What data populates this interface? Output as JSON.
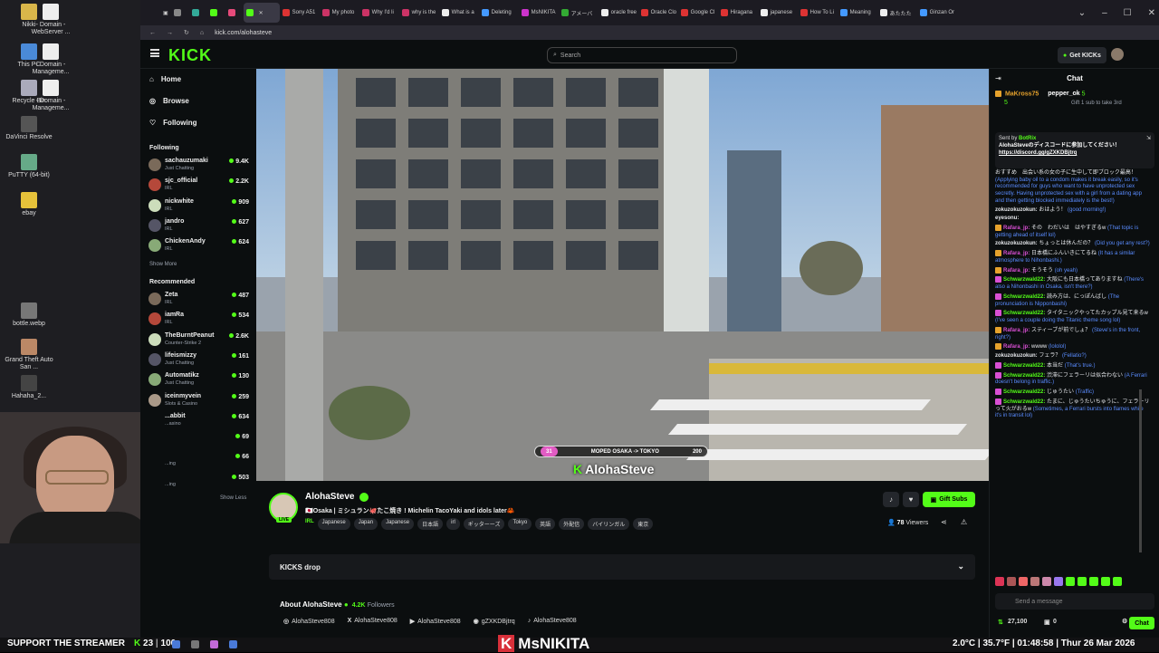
{
  "desktop": {
    "icons": [
      {
        "label": "Nikki",
        "color": "#d9b64a"
      },
      {
        "label": "- Domain - WebServer ...",
        "color": "#eee"
      },
      {
        "label": "This PC",
        "color": "#4a8ad8"
      },
      {
        "label": "- Domain - Manageme...",
        "color": "#eee"
      },
      {
        "label": "Recycle Bin",
        "color": "#aab"
      },
      {
        "label": "- Domain - Manageme...",
        "color": "#eee"
      },
      {
        "label": "DaVinci Resolve",
        "color": "#555"
      },
      {
        "label": "PuTTY (64-bit)",
        "color": "#6a8"
      },
      {
        "label": "ebay",
        "color": "#e6c23a"
      },
      {
        "label": "bottle.webp",
        "color": "#777"
      },
      {
        "label": "Grand Theft Auto San ...",
        "color": "#b86"
      },
      {
        "label": "Hahaha_2...",
        "color": "#444"
      }
    ]
  },
  "browser": {
    "tabs": [
      {
        "label": "",
        "color": "#888"
      },
      {
        "label": "",
        "color": "#3a9"
      },
      {
        "label": "",
        "color": "#53fc18"
      },
      {
        "label": "",
        "color": "#e64a7a"
      },
      {
        "label": "",
        "color": "#53fc18",
        "active": true
      },
      {
        "label": "Sony A51",
        "color": "#d33"
      },
      {
        "label": "My photo",
        "color": "#c36"
      },
      {
        "label": "Why I'd li",
        "color": "#c36"
      },
      {
        "label": "why is the",
        "color": "#c36"
      },
      {
        "label": "What is a",
        "color": "#eee"
      },
      {
        "label": "Deleting",
        "color": "#49f"
      },
      {
        "label": "MsNIKITA",
        "color": "#c3c"
      },
      {
        "label": "アメーバ",
        "color": "#3a3"
      },
      {
        "label": "oracle free",
        "color": "#eee"
      },
      {
        "label": "Oracle Clo",
        "color": "#d33"
      },
      {
        "label": "Google Cl",
        "color": "#d33"
      },
      {
        "label": "Hiragana",
        "color": "#d33"
      },
      {
        "label": "japanese",
        "color": "#eee"
      },
      {
        "label": "How To Li",
        "color": "#d33"
      },
      {
        "label": "Meaning",
        "color": "#49f"
      },
      {
        "label": "あたたた",
        "color": "#eee"
      },
      {
        "label": "Ginzan Or",
        "color": "#49f"
      }
    ],
    "url": "kick.com/alohasteve"
  },
  "topnav": {
    "logo": "KICK",
    "search_placeholder": "Search",
    "get_kicks": "Get KICKs"
  },
  "sidebar": {
    "nav": [
      "Home",
      "Browse",
      "Following"
    ],
    "following_title": "Following",
    "following": [
      {
        "name": "sachauzumaki",
        "category": "Just Chatting",
        "viewers": "9.4K"
      },
      {
        "name": "sjc_official",
        "category": "IRL",
        "viewers": "2.2K"
      },
      {
        "name": "nickwhite",
        "category": "IRL",
        "viewers": "909"
      },
      {
        "name": "jandro",
        "category": "IRL",
        "viewers": "627"
      },
      {
        "name": "ChickenAndy",
        "category": "IRL",
        "viewers": "624"
      }
    ],
    "show_more": "Show More",
    "recommended_title": "Recommended",
    "recommended": [
      {
        "name": "Zeta",
        "category": "IRL",
        "viewers": "487"
      },
      {
        "name": "iamRa",
        "category": "IRL",
        "viewers": "534"
      },
      {
        "name": "TheBurntPeanut",
        "category": "Counter-Strike 2",
        "viewers": "2.6K"
      },
      {
        "name": "lifeismizzy",
        "category": "Just Chatting",
        "viewers": "161"
      },
      {
        "name": "Automatikz",
        "category": "Just Chatting",
        "viewers": "130"
      },
      {
        "name": "iceinmyvein",
        "category": "Slots & Casino",
        "viewers": "259"
      },
      {
        "name": "...abbit",
        "category": "...asino",
        "viewers": "634"
      },
      {
        "name": "",
        "category": "",
        "viewers": "69"
      },
      {
        "name": "",
        "category": "...ing",
        "viewers": "66"
      },
      {
        "name": "",
        "category": "...ing",
        "viewers": "503"
      }
    ],
    "show_less": "Show Less"
  },
  "video": {
    "overlay_left": "31",
    "overlay_route": "MOPED OSAKA -> TOKYO",
    "overlay_right": "200",
    "overlay_name": "AlohaSteve"
  },
  "stream": {
    "channel": "AlohaSteve",
    "live_label": "LIVE",
    "title": "🇯🇵Osaka | ミシュラン🐙たこ焼き ! Michelin TacoYaki and idols later🦀",
    "category": "IRL",
    "tags": [
      "Japanese",
      "Japan",
      "Japanese",
      "日本語",
      "irl",
      "ギッターーズ",
      "Tokyo",
      "英語",
      "外配信",
      "バイリンガル",
      "東京"
    ],
    "gift_label": "Gift Subs",
    "viewers": "78",
    "viewers_label": "Viewers",
    "kicks_drop": "KICKS drop",
    "about_title": "About AlohaSteve",
    "followers": "4.2K",
    "followers_label": "Followers",
    "socials": [
      {
        "icon": "instagram-icon",
        "label": "AlohaSteve808"
      },
      {
        "icon": "x-icon",
        "label": "AlohaSteve808"
      },
      {
        "icon": "youtube-icon",
        "label": "AlohaSteve808"
      },
      {
        "icon": "discord-icon",
        "label": "gZXKDBjtrq"
      },
      {
        "icon": "tiktok-icon",
        "label": "AlohaSteve808"
      }
    ]
  },
  "chat": {
    "title": "Chat",
    "gift_user1": "MaKross75",
    "gift_user1_count": "5",
    "gift_user2": "pepper_ok",
    "gift_user2_count": "5",
    "gift_note": "Gift 1 sub to take 3rd",
    "pinned_sender": "Sent by",
    "pinned_bot": "BotRix",
    "pinned_text": "AlohaSteveのディスコードに参加してください！",
    "pinned_link": "https://discord.gg/gZXKDBjtrq",
    "messages": [
      {
        "user": "",
        "color": "#e5e7eb",
        "text": "おすすめ　出会い系の女の子に生中して即ブロック最高！",
        "translation": "(Applying baby oil to a condom makes it break easily, so it's recommended for guys who want to have unprotected sex secretly. Having unprotected sex with a girl from a dating app and then getting blocked immediately is the best!)"
      },
      {
        "user": "zokuzokuzokun:",
        "color": "#e5e7eb",
        "text": "おはよう！",
        "translation": "(good morning!)"
      },
      {
        "user": "eyesonu:",
        "color": "#e5e7eb",
        "text": "",
        "translation": ""
      },
      {
        "user": "Rafara_jp:",
        "color": "#d94fd4",
        "text": "その　わだいは　はやすぎるw",
        "translation": "(That topic is getting ahead of itself lol)"
      },
      {
        "user": "zokuzokuzokun:",
        "color": "#e5e7eb",
        "text": "ちょっとは休んだの？",
        "translation": "(Did you get any rest?)"
      },
      {
        "user": "Rafara_jp:",
        "color": "#d94fd4",
        "text": "日本橋にふんいきにてるね",
        "translation": "(It has a similar atmosphere to Nihonbashi.)"
      },
      {
        "user": "Rafara_jp:",
        "color": "#d94fd4",
        "text": "そうそう",
        "translation": "(oh yeah)"
      },
      {
        "user": "Schwarzwald22:",
        "color": "#53fc18",
        "text": "大阪にも日本橋ってありますね",
        "translation": "(There's also a Nihonbashi in Osaka, isn't there?)"
      },
      {
        "user": "Schwarzwald22:",
        "color": "#53fc18",
        "text": "読み方は、にっぽんばし",
        "translation": "(The pronunciation is Nipponbashi)"
      },
      {
        "user": "Schwarzwald22:",
        "color": "#53fc18",
        "text": "タイタニックやってたカップル見て来るw",
        "translation": "(I've seen a couple doing the Titanic theme song lol)"
      },
      {
        "user": "Rafara_jp:",
        "color": "#d94fd4",
        "text": "スティーブが前でしょ？",
        "translation": "(Steve's in the front, right?)"
      },
      {
        "user": "Rafara_jp:",
        "color": "#d94fd4",
        "text": "wwww",
        "translation": "(lololol)"
      },
      {
        "user": "zokuzokuzokun:",
        "color": "#e5e7eb",
        "text": "フェラ？",
        "translation": "(Fellatio?)"
      },
      {
        "user": "Schwarzwald22:",
        "color": "#53fc18",
        "text": "本当だ",
        "translation": "(That's true.)"
      },
      {
        "user": "Schwarzwald22:",
        "color": "#53fc18",
        "text": "渋滞にフェラーリは似合わない",
        "translation": "(A Ferrari doesn't belong in traffic.)"
      },
      {
        "user": "Schwarzwald22:",
        "color": "#53fc18",
        "text": "じゅうたい",
        "translation": "(Traffic)"
      },
      {
        "user": "Schwarzwald22:",
        "color": "#53fc18",
        "text": "たまに、じゅうたいちゅうに、フェラーリって火がおるw",
        "translation": "(Sometimes, a Ferrari bursts into flames while it's in transit lol)"
      }
    ],
    "send_placeholder": "Send a message",
    "kicks_balance": "27,100",
    "count": "0",
    "chat_button": "Chat"
  },
  "taskbar": {
    "support": "SUPPORT THE STREAMER",
    "kicks_count": "23",
    "subs_count": "100",
    "brand": "MsNIKITA",
    "weather": "2.0°C | 35.7°F | 01:48:58 | Thur 26 Mar 2026"
  }
}
